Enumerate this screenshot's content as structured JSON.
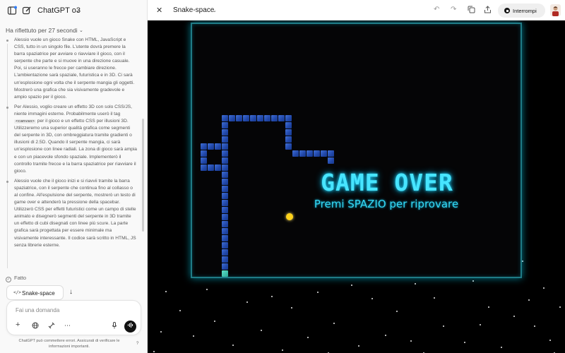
{
  "chat": {
    "model_name": "ChatGPT o3",
    "reasoning_header": "Ha riflettuto per 27 secondi",
    "thoughts": [
      "Alessio vuole un gioco Snake con HTML, JavaScript e CSS, tutto in un singolo file. L'utente dovrà premere la barra spaziatrice per avviare o riavviare il gioco, con il serpente che parte e si muove in una direzione casuale. Poi, si useranno le frecce per cambiare direzione. L'ambientazione sarà spaziale, futuristica e in 3D. Ci sarà un'esplosione ogni volta che il serpente mangia gli oggetti. Mostrerò una grafica che sia visivamente gradevole e ampio spazio per il gioco.",
      "Per Alessio, voglio creare un effetto 3D con solo CSS/JS, niente immagini esterne. Probabilmente userò il tag",
      "per il gioco e un effetto CSS per illusioni 3D. Utilizzeremo una superior qualità grafica come segmenti del serpente in 3D, con ombreggiatura tramite gradienti o illusioni di 2.5D. Quando il serpente mangia, ci sarà un'esplosione con linee radiali. La zona di gioco sarà ampia e con un piacevole sfondo spaziale. Implementerò il controllo tramite frecce e la barra spaziatrice per riavviare il gioco.",
      "Alessio vuole che il gioco inizi e si riavvii tramite la barra spaziatrice, con il serpente che continua fino al collasso o al confine. All'espulsione del serpente, mostrerò un testo di game over e attenderò la pressione della spacebar. Utilizzerò CSS per effetti futuristici come un campo di stelle animato e disegnerò segmenti del serpente in 3D tramite un effetto di cubi disegnati con linee più scure. La parte grafica sarà progettata per essere minimale ma visivamente interessante. Il codice sarà scritto in HTML, JS senza librerie esterne."
    ],
    "code_tag": "<canvas>",
    "done_label": "Fatto",
    "canvas_chip_label": "Snake-space",
    "composer_placeholder": "Fai una domanda",
    "disclaimer": "ChatGPT può commettere errori. Assicurati di verificare le informazioni importanti.",
    "help": "?"
  },
  "canvas": {
    "title": "Snake-space",
    "stop_label": "Interrompi"
  },
  "game": {
    "title": "GAME OVER",
    "subtitle": "Premi SPAZIO per riprovare"
  },
  "colors": {
    "neon": "#47e5ff",
    "frame": "#1f7b86",
    "snake": "#2a56bf",
    "food": "#ffd21a"
  }
}
